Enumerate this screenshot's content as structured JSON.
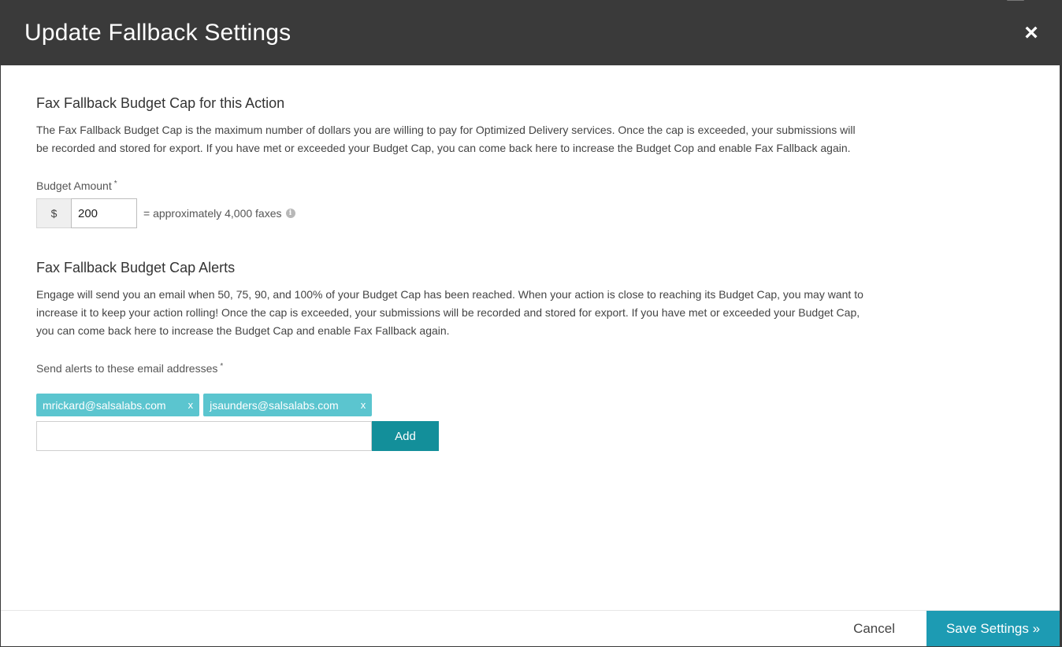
{
  "modal": {
    "title": "Update Fallback Settings",
    "close_label": "×"
  },
  "budget_section": {
    "title": "Fax Fallback Budget Cap for this Action",
    "description": "The Fax Fallback Budget Cap is the maximum number of dollars you are willing to pay for Optimized Delivery services. Once the cap is exceeded, your submissions will be recorded and stored for export. If you have met or exceeded your Budget Cap, you can come back here to increase the Budget Cop and enable Fax Fallback again.",
    "amount_label": "Budget Amount",
    "required_marker": "*",
    "currency_symbol": "$",
    "amount_value": "200",
    "approx_text": "= approximately 4,000 faxes",
    "info_icon_glyph": "i"
  },
  "alerts_section": {
    "title": "Fax Fallback Budget Cap Alerts",
    "description": "Engage will send you an email when 50, 75, 90, and 100% of your Budget Cap has been reached. When your action is close to reaching its Budget Cap, you may want to increase it to keep your action rolling! Once the cap is exceeded, your submissions will be recorded and stored for export. If you have met or exceeded your Budget Cap, you can come back here to increase the Budget Cap and enable Fax Fallback again.",
    "email_label": "Send alerts to these email addresses",
    "required_marker": "*",
    "emails": [
      {
        "address": "mrickard@salsalabs.com",
        "remove": "x"
      },
      {
        "address": "jsaunders@salsalabs.com",
        "remove": "x"
      }
    ],
    "email_input_value": "",
    "add_label": "Add"
  },
  "footer": {
    "cancel_label": "Cancel",
    "save_label": "Save Settings »"
  },
  "colors": {
    "header_bg": "#3a3a3a",
    "tag_bg": "#5bc5cf",
    "add_btn_bg": "#138f9a",
    "save_btn_bg": "#1d9bb3"
  }
}
